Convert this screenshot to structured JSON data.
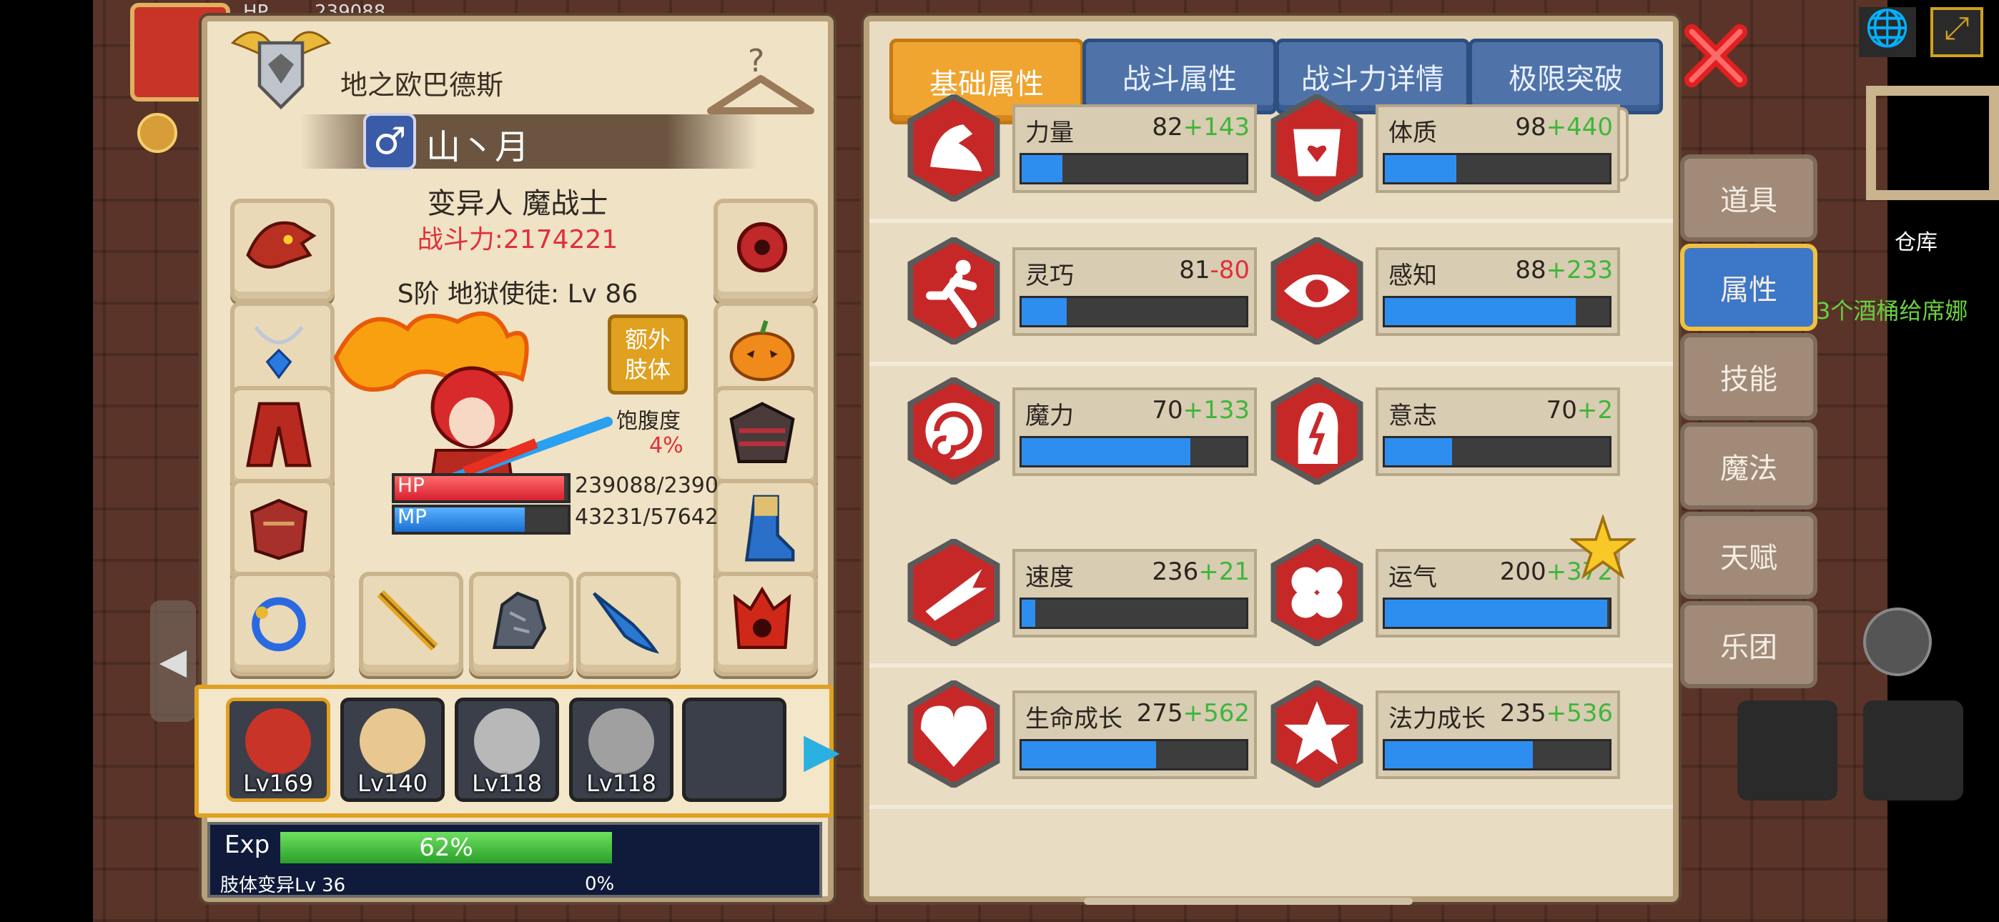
{
  "colors": {
    "accent": "#f0a530",
    "bonus_positive": "#3fb63a",
    "bonus_negative": "#e0303a",
    "power_red": "#e0303a",
    "stat_bar": "#2e8ef0",
    "exp_bar": "#3cbc3c"
  },
  "hud": {
    "top_hp_label": "HP",
    "top_hp_value": "239088",
    "warehouse_label": "仓库",
    "quest_text": "3个酒桶给席娜",
    "side_char_text": "酒"
  },
  "character": {
    "title": "地之欧巴德斯",
    "gender_icon": "male-icon",
    "name": "山丶月",
    "class_line": "变异人 魔战士",
    "power_text": "战斗力:2174221",
    "rank_line": "S阶 地狱使徒: Lv 86",
    "extra_limbs_button": "额外\n肢体",
    "satiety_label": "饱腹度",
    "satiety_value": "4%",
    "satiety_fraction": 0.04,
    "hp_label": "HP",
    "hp_value": "239088/2390",
    "hp_fraction": 0.98,
    "mp_label": "MP",
    "mp_value": "43231/57642",
    "mp_fraction": 0.75,
    "exp_label": "Exp",
    "exp_value": "62%",
    "exp_fraction": 0.62,
    "mutation_label": "肢体变异Lv 36",
    "mutation_value": "0%",
    "mutation_fraction": 0.0
  },
  "party": [
    {
      "level": "Lv169",
      "icon": "red-hair-portrait-icon"
    },
    {
      "level": "Lv140",
      "icon": "blonde-maid-portrait-icon"
    },
    {
      "level": "Lv118",
      "icon": "grey-maid-portrait-icon"
    },
    {
      "level": "Lv118",
      "icon": "grey-maid-portrait-icon"
    }
  ],
  "tabs": [
    {
      "label": "基础属性",
      "active": true
    },
    {
      "label": "战斗属性",
      "active": false
    },
    {
      "label": "战斗力详情",
      "active": false
    },
    {
      "label": "极限突破",
      "active": false
    }
  ],
  "stats": [
    {
      "label": "力量",
      "base": "82",
      "bonus": "+143",
      "positive": true,
      "fraction": 0.18,
      "icon": "muscle-arm-icon"
    },
    {
      "label": "体质",
      "base": "98",
      "bonus": "+440",
      "positive": true,
      "fraction": 0.32,
      "icon": "torso-heart-icon"
    },
    {
      "label": "灵巧",
      "base": "81",
      "bonus": "-80",
      "positive": false,
      "fraction": 0.2,
      "icon": "running-man-icon"
    },
    {
      "label": "感知",
      "base": "88",
      "bonus": "+233",
      "positive": true,
      "fraction": 0.85,
      "icon": "eye-icon"
    },
    {
      "label": "魔力",
      "base": "70",
      "bonus": "+133",
      "positive": true,
      "fraction": 0.75,
      "icon": "swirl-icon"
    },
    {
      "label": "意志",
      "base": "70",
      "bonus": "+2",
      "positive": true,
      "fraction": 0.3,
      "icon": "head-lightning-icon"
    },
    {
      "label": "速度",
      "base": "236",
      "bonus": "+21",
      "positive": true,
      "fraction": 0.06,
      "icon": "speed-wing-icon"
    },
    {
      "label": "运气",
      "base": "200",
      "bonus": "+372",
      "positive": true,
      "fraction": 0.99,
      "icon": "four-leaf-clover-icon"
    },
    {
      "label": "生命成长",
      "base": "275",
      "bonus": "+562",
      "positive": true,
      "fraction": 0.6,
      "icon": "heart-growth-icon"
    },
    {
      "label": "法力成长",
      "base": "235",
      "bonus": "+536",
      "positive": true,
      "fraction": 0.66,
      "icon": "magic-sigil-icon"
    }
  ],
  "side_menu": [
    {
      "label": "道具",
      "active": false
    },
    {
      "label": "属性",
      "active": true
    },
    {
      "label": "技能",
      "active": false
    },
    {
      "label": "魔法",
      "active": false
    },
    {
      "label": "天赋",
      "active": false
    },
    {
      "label": "乐团",
      "active": false
    }
  ]
}
